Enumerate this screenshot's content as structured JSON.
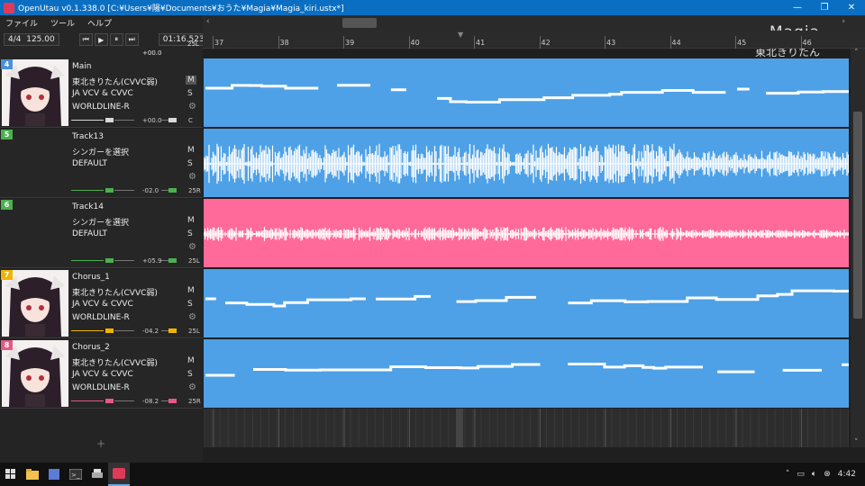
{
  "window": {
    "title": "OpenUtau v0.1.338.0 [C:¥Users¥陽¥Documents¥おうた¥Magia¥Magia_kiri.ustx*]",
    "minimize": "—",
    "restore": "❐",
    "close": "✕"
  },
  "menu": [
    "ファイル",
    "ツール",
    "ヘルプ"
  ],
  "toolbar": {
    "time_signature": "4/4",
    "bpm": "125.00",
    "time": "01:16.523",
    "master_pan": "25L",
    "master_volume": "+00.0",
    "master_c": "C"
  },
  "ruler": {
    "bars": [
      "37",
      "38",
      "39",
      "40",
      "41",
      "42",
      "43",
      "44",
      "45",
      "46"
    ]
  },
  "branding": {
    "title": "Magia",
    "subtitle": "東北きりたん"
  },
  "tracks": [
    {
      "number": "4",
      "number_color": "#4a90d9",
      "name": "Main",
      "singer": "東北きりたん(CVVC弱)",
      "phonemizer": "JA VCV & CVVC",
      "renderer": "WORLDLINE-R",
      "mute": "M",
      "solo": "S",
      "volume": "+00.0",
      "pan": "C",
      "accent": "#d9d9d9"
    },
    {
      "number": "5",
      "number_color": "#4caf50",
      "name": "Track13",
      "singer": "シンガーを選択",
      "phonemizer": "DEFAULT",
      "renderer": "",
      "mute": "M",
      "solo": "S",
      "volume": "-02.0",
      "pan": "25R",
      "accent": "#4caf50"
    },
    {
      "number": "6",
      "number_color": "#4caf50",
      "name": "Track14",
      "singer": "シンガーを選択",
      "phonemizer": "DEFAULT",
      "renderer": "",
      "mute": "M",
      "solo": "S",
      "volume": "+05.9",
      "pan": "25L",
      "accent": "#4caf50"
    },
    {
      "number": "7",
      "number_color": "#f0b400",
      "name": "Chorus_1",
      "singer": "東北きりたん(CVVC弱)",
      "phonemizer": "JA VCV & CVVC",
      "renderer": "WORLDLINE-R",
      "mute": "M",
      "solo": "S",
      "volume": "-04.2",
      "pan": "25L",
      "accent": "#f0b400"
    },
    {
      "number": "8",
      "number_color": "#e35a86",
      "name": "Chorus_2",
      "singer": "東北きりたん(CVVC弱)",
      "phonemizer": "JA VCV & CVVC",
      "renderer": "WORLDLINE-R",
      "mute": "M",
      "solo": "S",
      "volume": "-08.2",
      "pan": "25R",
      "accent": "#e35a86"
    }
  ],
  "lane_colors": {
    "blue": "#4ea1e6",
    "pink": "#ff6a9b"
  },
  "add_track": "+",
  "taskbar": {
    "clock": "4:42",
    "icons": [
      "windows-start-icon",
      "file-explorer-icon",
      "app-icon",
      "terminal-icon",
      "printer-icon",
      "openutau-icon"
    ]
  }
}
